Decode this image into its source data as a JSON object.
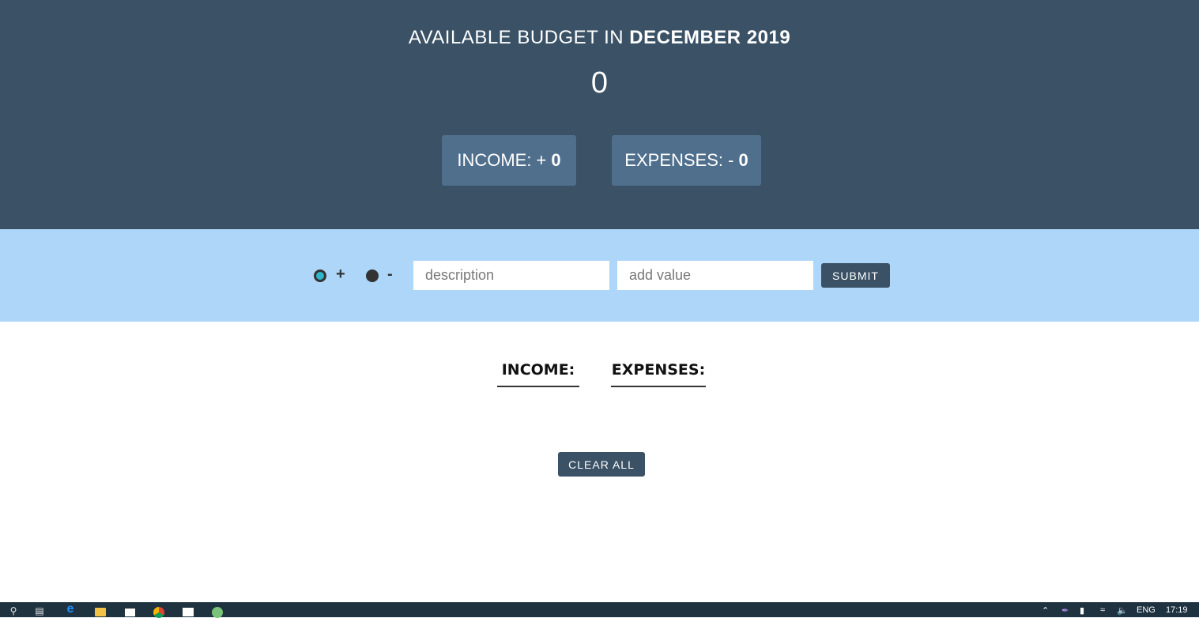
{
  "header": {
    "title_prefix": "AVAILABLE BUDGET IN",
    "month": "DECEMBER 2019",
    "budget_value": "0",
    "income": {
      "label": "INCOME: +",
      "value": "0"
    },
    "expenses": {
      "label": "EXPENSES: -",
      "value": "0"
    }
  },
  "form": {
    "radio_plus_label": "+",
    "radio_minus_label": "-",
    "description_placeholder": "description",
    "value_placeholder": "add value",
    "submit_label": "SUBMIT"
  },
  "lists": {
    "income_header": "INCOME:",
    "expenses_header": "EXPENSES:"
  },
  "clear_all_label": "CLEAR ALL",
  "taskbar": {
    "language": "ENG",
    "time": "17:19"
  },
  "colors": {
    "header_bg": "#3a5166",
    "summary_box_bg": "#4f6f8c",
    "form_bar_bg": "#add6f8",
    "button_bg": "#3a5166",
    "radio_checked": "#2fb7c9"
  }
}
